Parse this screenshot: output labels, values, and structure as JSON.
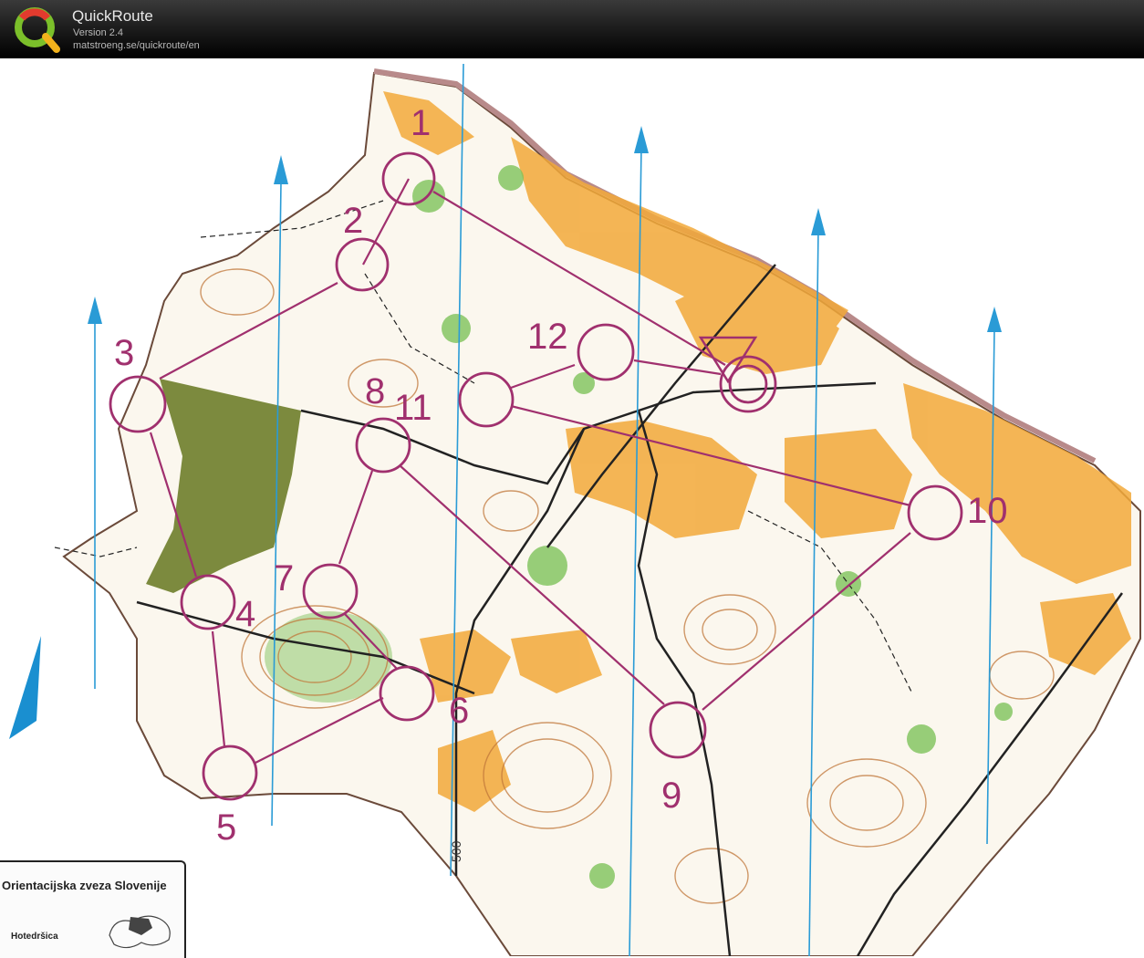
{
  "app": {
    "name": "QuickRoute",
    "version": "Version 2.4",
    "url": "matstroeng.se/quickroute/en"
  },
  "map": {
    "controls": [
      {
        "label": "1"
      },
      {
        "label": "2"
      },
      {
        "label": "3"
      },
      {
        "label": "4"
      },
      {
        "label": "5"
      },
      {
        "label": "6"
      },
      {
        "label": "7"
      },
      {
        "label": "8"
      },
      {
        "label": "9"
      },
      {
        "label": "10"
      },
      {
        "label": "11"
      },
      {
        "label": "12"
      }
    ],
    "legend": {
      "title": "Orientacijska zveza Slovenije",
      "place": "Hotedršica"
    },
    "scale_text": "500",
    "colors": {
      "course": "#a0306e",
      "open_land": "#f2a93a",
      "forest_green": "#7fc25a",
      "dark_green": "#6e7d2a",
      "contour": "#c0773a",
      "north_line": "#2a9bd6"
    }
  }
}
